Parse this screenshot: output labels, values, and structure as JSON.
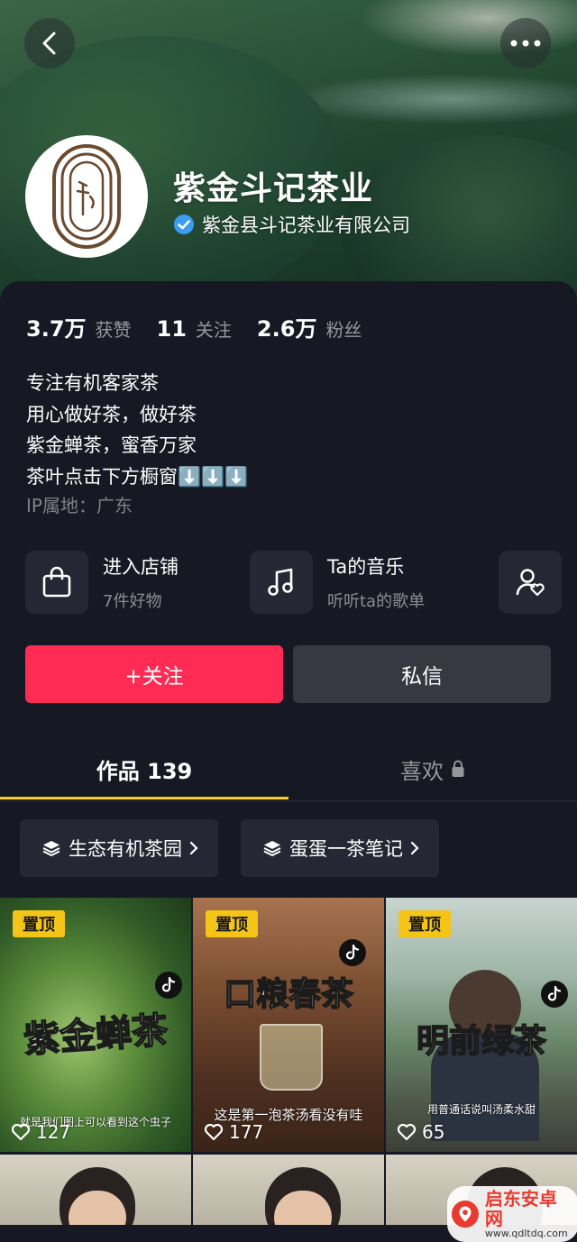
{
  "header": {
    "account_name": "紫金斗记茶业",
    "verified_org": "紫金县斗记茶业有限公司"
  },
  "stats": [
    {
      "value": "3.7万",
      "label": "获赞"
    },
    {
      "value": "11",
      "label": "关注"
    },
    {
      "value": "2.6万",
      "label": "粉丝"
    }
  ],
  "bio": {
    "lines": [
      "专注有机客家茶",
      "用心做好茶，做好茶",
      "紫金蝉茶，蜜香万家",
      "茶叶点击下方橱窗⬇️⬇️⬇️"
    ],
    "ip": "IP属地：广东"
  },
  "entries": [
    {
      "title": "进入店铺",
      "subtitle": "7件好物",
      "icon": "shopping-bag-icon"
    },
    {
      "title": "Ta的音乐",
      "subtitle": "听听ta的歌单",
      "icon": "music-note-icon"
    },
    {
      "title": "",
      "subtitle": "",
      "icon": "user-heart-icon"
    }
  ],
  "actions": {
    "follow": "+关注",
    "message": "私信"
  },
  "tabs": {
    "works": "作品 139",
    "likes": "喜欢"
  },
  "collections": [
    "生态有机茶园",
    "蛋蛋一茶笔记"
  ],
  "videos": [
    {
      "pinned": "置顶",
      "overlay": "紫金蝉茶",
      "subtitle": "就是我们图上可以看到这个虫子",
      "likes": "127"
    },
    {
      "pinned": "置顶",
      "overlay": "口粮春茶",
      "subtitle": "这是第一泡茶汤看没有哇",
      "likes": "177"
    },
    {
      "pinned": "置顶",
      "overlay": "明前绿茶",
      "subtitle": "用普通话说叫汤柔水甜",
      "likes": "65"
    }
  ],
  "watermark": {
    "name": "启东安卓网",
    "url": "www.qdltdq.com"
  },
  "colors": {
    "accent_follow": "#fe2c55",
    "tab_indicator": "#facf16",
    "pin_badge": "#f5c419",
    "background": "#161823"
  }
}
